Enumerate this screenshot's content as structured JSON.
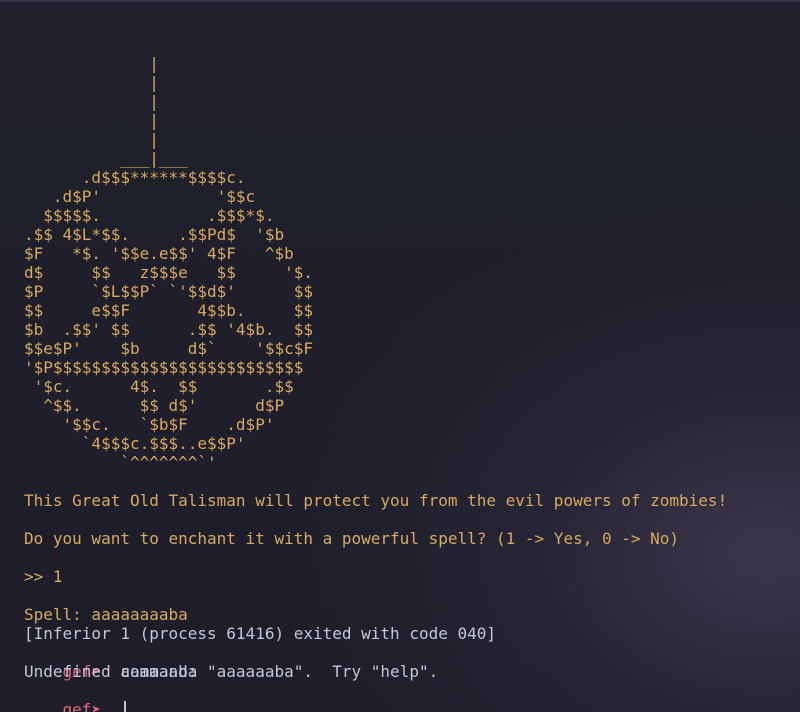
{
  "ascii_art": "             |\n             |\n             |\n             |\n             |\n          ___|___\n      .d$$$******$$$$c.\n   .d$P'            '$$c\n  $$$$$.           .$$$*$.\n.$$ 4$L*$$.     .$$Pd$  '$b\n$F   *$. '$$e.e$$' 4$F   ^$b\nd$     $$   z$$$e   $$     '$.\n$P     `$L$$P` `'$$d$'      $$\n$$     e$$F       4$$b.     $$\n$b  .$$' $$      .$$ '4$b.  $$\n$$e$P'    $b     d$`    '$$c$F\n'$P$$$$$$$$$$$$$$$$$$$$$$$$$$\n '$c.      4$.  $$       .$$\n  ^$$.      $$ d$'      d$P\n    '$$c.   `$b$F    .d$P'\n      `4$$$c.$$$..e$$P'\n          `^^^^^^^`'",
  "output": {
    "talisman_message": "This Great Old Talisman will protect you from the evil powers of zombies!",
    "enchant_question": "Do you want to enchant it with a powerful spell? (1 -> Yes, 0 -> No)",
    "user_choice": ">> 1",
    "spell_line": "Spell: aaaaaaaaba",
    "exit_message": "[Inferior 1 (process 61416) exited with code 040]"
  },
  "gdb": {
    "prompt": "gef➤",
    "entered_command": "aaaaaaba",
    "error_message": "Undefined command: \"aaaaaaba\".  Try \"help\".",
    "current_input": ""
  },
  "colors": {
    "background": "#1e1f2a",
    "program_output": "#d8a95e",
    "gdb_text": "#c3c6d6",
    "prompt": "#e0637b"
  }
}
